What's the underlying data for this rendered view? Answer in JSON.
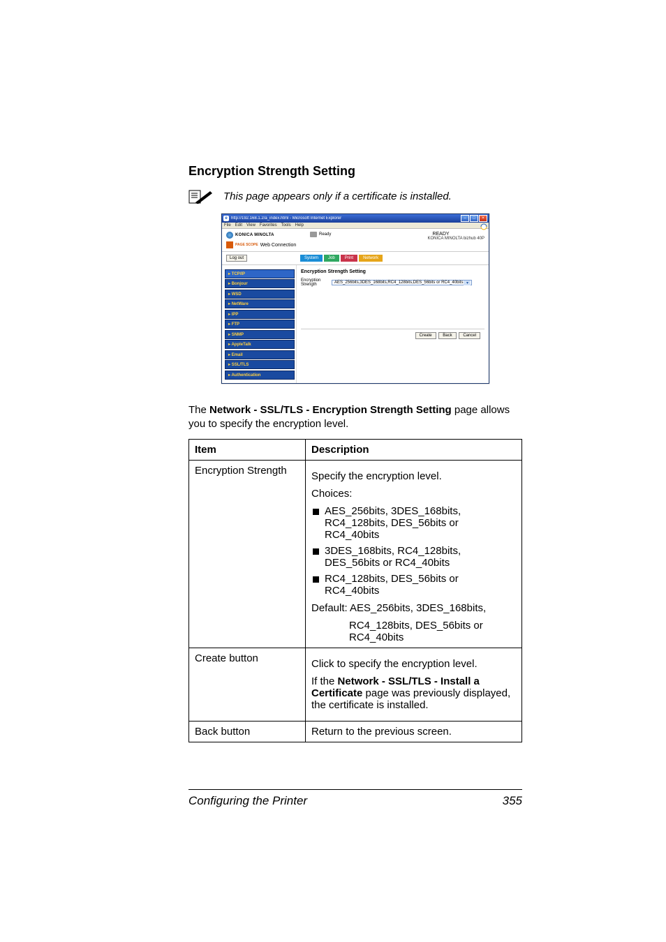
{
  "page": {
    "title": "Encryption Strength Setting",
    "note": "This page appears only if a certificate is installed.",
    "intro_prefix": "The ",
    "intro_bold": "Network - SSL/TLS - Encryption Strength Setting",
    "intro_suffix": " page allows you to specify the encryption level.",
    "footer_left": "Configuring the Printer",
    "footer_right": "355"
  },
  "browser": {
    "title": "http://192.168.1.2/a_index.html - Microsoft Internet Explorer",
    "menus": [
      "File",
      "Edit",
      "View",
      "Favorites",
      "Tools",
      "Help"
    ],
    "brand_top": "KONICA MINOLTA",
    "brand_sub_prefix": "PAGE SCOPE",
    "brand_sub": "Web Connection",
    "status": "Ready",
    "ready": "READY",
    "model": "KONICA MINOLTA bizhub 40P",
    "logout": "Log out",
    "tabs": {
      "system": "System",
      "job": "Job",
      "print": "Print",
      "network": "Network"
    },
    "sidebar": [
      "TCP/IP",
      "Bonjour",
      "WSD",
      "NetWare",
      "IPP",
      "FTP",
      "SNMP",
      "AppleTalk",
      "Email",
      "SSL/TLS",
      "Authentication"
    ],
    "main_title": "Encryption Strength Setting",
    "field_label": "Encryption Strength",
    "select_value": "AES_256bits,3DES_168bits,RC4_128bits,DES_56bits or RC4_40bits",
    "buttons": {
      "create": "Create",
      "back": "Back",
      "cancel": "Cancel"
    }
  },
  "table": {
    "head_item": "Item",
    "head_desc": "Description",
    "r1_item": "Encryption Strength",
    "r1_l1": "Specify the encryption level.",
    "r1_l2": "Choices:",
    "r1_b1": "AES_256bits, 3DES_168bits, RC4_128bits, DES_56bits or RC4_40bits",
    "r1_b2": "3DES_168bits, RC4_128bits, DES_56bits or RC4_40bits",
    "r1_b3": "RC4_128bits, DES_56bits or RC4_40bits",
    "r1_def1": "Default:  AES_256bits, 3DES_168bits,",
    "r1_def2": "RC4_128bits, DES_56bits or RC4_40bits",
    "r2_item": "Create button",
    "r2_l1": "Click to specify the encryption level.",
    "r2_l2a": "If the ",
    "r2_l2b": "Network - SSL/TLS - Install a Certificate",
    "r2_l2c": " page was previously displayed, the certificate is installed.",
    "r3_item": "Back button",
    "r3_l1": "Return to the previous screen."
  }
}
